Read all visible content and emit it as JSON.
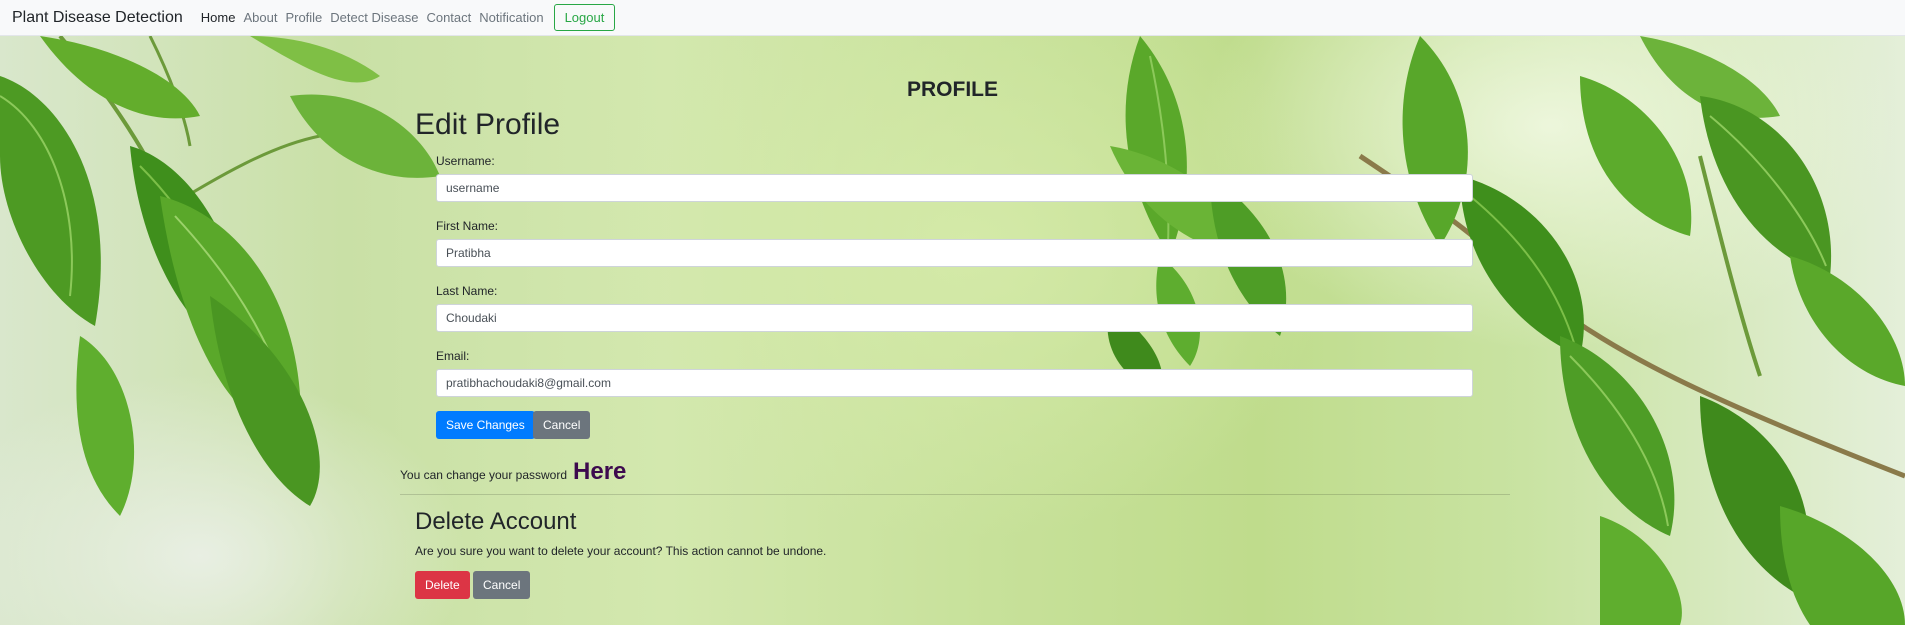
{
  "navbar": {
    "brand": "Plant Disease Detection",
    "links": [
      {
        "label": "Home"
      },
      {
        "label": "About"
      },
      {
        "label": "Profile"
      },
      {
        "label": "Detect Disease"
      },
      {
        "label": "Contact"
      },
      {
        "label": "Notification"
      }
    ],
    "logout_label": "Logout"
  },
  "page": {
    "title": "PROFILE"
  },
  "edit_profile": {
    "heading": "Edit Profile",
    "fields": [
      {
        "label": "Username:",
        "value": "username"
      },
      {
        "label": "First Name:",
        "value": "Pratibha"
      },
      {
        "label": "Last Name:",
        "value": "Choudaki"
      },
      {
        "label": "Email:",
        "value": "pratibhachoudaki8@gmail.com"
      }
    ],
    "save_label": "Save Changes",
    "cancel_label": "Cancel"
  },
  "password": {
    "text": "You can change your password",
    "link_label": "Here"
  },
  "delete_account": {
    "heading": "Delete Account",
    "message": "Are you sure you want to delete your account? This action cannot be undone.",
    "delete_label": "Delete",
    "cancel_label": "Cancel"
  },
  "colors": {
    "primary": "#007bff",
    "secondary": "#6c757d",
    "danger": "#dc3545",
    "success": "#28a745",
    "here_link": "#3d0a4e"
  }
}
